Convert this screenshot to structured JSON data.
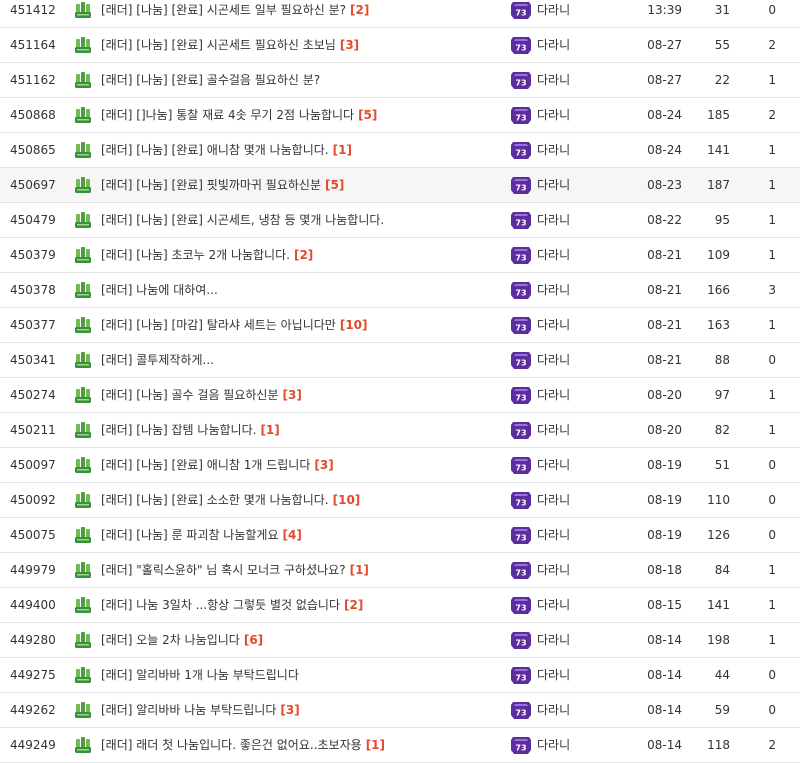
{
  "colors": {
    "comment_count": "#e24a2b",
    "category_icon": "#3a8f3a",
    "badge": "#5b2d9e",
    "row_highlight": "#f6f6f6"
  },
  "icons": {
    "category": "ladder-category-icon",
    "level_badge": "level-73-badge-icon"
  },
  "badge_text": "73",
  "posts": [
    {
      "id": "451412",
      "title": "[래더] [나눔] [완료] 시곤세트 일부 필요하신 분?",
      "comments": "[2]",
      "author": "다라니",
      "date": "13:39",
      "views": "31",
      "likes": "0"
    },
    {
      "id": "451164",
      "title": "[래더] [나눔] [완료] 시곤세트 필요하신 초보님",
      "comments": "[3]",
      "author": "다라니",
      "date": "08-27",
      "views": "55",
      "likes": "2"
    },
    {
      "id": "451162",
      "title": "[래더] [나눔] [완료] 골수걸음 필요하신 분?",
      "comments": "",
      "author": "다라니",
      "date": "08-27",
      "views": "22",
      "likes": "1"
    },
    {
      "id": "450868",
      "title": "[래더] []나눔] 통찰 재료 4솟 무기 2점 나눔합니다",
      "comments": "[5]",
      "author": "다라니",
      "date": "08-24",
      "views": "185",
      "likes": "2"
    },
    {
      "id": "450865",
      "title": "[래더] [나눔] [완료] 애니참 몇개 나눔합니다.",
      "comments": "[1]",
      "author": "다라니",
      "date": "08-24",
      "views": "141",
      "likes": "1"
    },
    {
      "id": "450697",
      "title": "[래더] [나눔] [완료] 핏빛까마귀 필요하신분",
      "comments": "[5]",
      "author": "다라니",
      "date": "08-23",
      "views": "187",
      "likes": "1",
      "highlight": true
    },
    {
      "id": "450479",
      "title": "[래더] [나눔] [완료] 시곤세트, 냉참 등 몇개 나눔합니다.",
      "comments": "",
      "author": "다라니",
      "date": "08-22",
      "views": "95",
      "likes": "1"
    },
    {
      "id": "450379",
      "title": "[래더] [나눔] 초코누 2개 나눔합니다.",
      "comments": "[2]",
      "author": "다라니",
      "date": "08-21",
      "views": "109",
      "likes": "1"
    },
    {
      "id": "450378",
      "title": "[래더] 나눔에 대하여...",
      "comments": "",
      "author": "다라니",
      "date": "08-21",
      "views": "166",
      "likes": "3"
    },
    {
      "id": "450377",
      "title": "[래더] [나눔] [마감] 탈라샤 세트는 아닙니다만",
      "comments": "[10]",
      "author": "다라니",
      "date": "08-21",
      "views": "163",
      "likes": "1"
    },
    {
      "id": "450341",
      "title": "[래더] 콜투제작하게...",
      "comments": "",
      "author": "다라니",
      "date": "08-21",
      "views": "88",
      "likes": "0"
    },
    {
      "id": "450274",
      "title": "[래더] [나눔] 골수 걸음 필요하신분",
      "comments": "[3]",
      "author": "다라니",
      "date": "08-20",
      "views": "97",
      "likes": "1"
    },
    {
      "id": "450211",
      "title": "[래더] [나눔] 잡템 나눔합니다.",
      "comments": "[1]",
      "author": "다라니",
      "date": "08-20",
      "views": "82",
      "likes": "1"
    },
    {
      "id": "450097",
      "title": "[래더] [나눔] [완료] 애니참 1개 드립니다",
      "comments": "[3]",
      "author": "다라니",
      "date": "08-19",
      "views": "51",
      "likes": "0"
    },
    {
      "id": "450092",
      "title": "[래더] [나눔] [완료] 소소한 몇개 나눔합니다.",
      "comments": "[10]",
      "author": "다라니",
      "date": "08-19",
      "views": "110",
      "likes": "0"
    },
    {
      "id": "450075",
      "title": "[래더] [나눔] 룬 파괴참 나눔할게요",
      "comments": "[4]",
      "author": "다라니",
      "date": "08-19",
      "views": "126",
      "likes": "0"
    },
    {
      "id": "449979",
      "title": "[래더] \"홀릭스윤하\" 님 혹시 모너크 구하셨나요?",
      "comments": "[1]",
      "author": "다라니",
      "date": "08-18",
      "views": "84",
      "likes": "1"
    },
    {
      "id": "449400",
      "title": "[래더] 나눔 3일차 ...항상 그렇듯 별것 없습니다",
      "comments": "[2]",
      "author": "다라니",
      "date": "08-15",
      "views": "141",
      "likes": "1"
    },
    {
      "id": "449280",
      "title": "[래더] 오늘 2차 나눔입니다",
      "comments": "[6]",
      "author": "다라니",
      "date": "08-14",
      "views": "198",
      "likes": "1"
    },
    {
      "id": "449275",
      "title": "[래더] 알리바바 1개 나눔 부탁드립니다",
      "comments": "",
      "author": "다라니",
      "date": "08-14",
      "views": "44",
      "likes": "0"
    },
    {
      "id": "449262",
      "title": "[래더] 알리바바 나눔 부탁드립니다",
      "comments": "[3]",
      "author": "다라니",
      "date": "08-14",
      "views": "59",
      "likes": "0"
    },
    {
      "id": "449249",
      "title": "[래더] 래더 첫 나눔입니다. 좋은건 없어요..초보자용",
      "comments": "[1]",
      "author": "다라니",
      "date": "08-14",
      "views": "118",
      "likes": "2"
    }
  ]
}
